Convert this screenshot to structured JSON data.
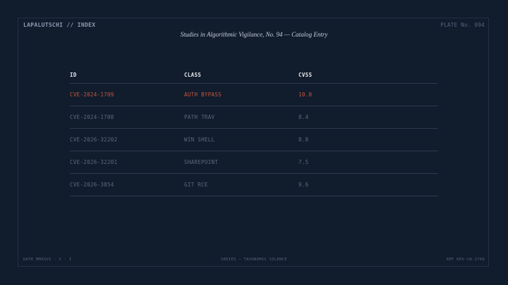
{
  "header": {
    "brand": "LAPALUTSCHI // INDEX",
    "plate": "PLATE No. 094",
    "subtitle": "Studies in Algorithmic Vigilance, No. 94 — Catalog Entry"
  },
  "table": {
    "columns": [
      "ID",
      "CLASS",
      "CVSS"
    ],
    "rows": [
      {
        "id": "CVE-2024-1709",
        "class": "AUTH BYPASS",
        "cvss": "10.0",
        "highlighted": true
      },
      {
        "id": "CVE-2024-1708",
        "class": "PATH TRAV",
        "cvss": "8.4",
        "highlighted": false
      },
      {
        "id": "CVE-2026-32202",
        "class": "WIN SHELL",
        "cvss": "8.8",
        "highlighted": false
      },
      {
        "id": "CVE-2026-32201",
        "class": "SHAREPOINT",
        "cvss": "7.5",
        "highlighted": false
      },
      {
        "id": "CVE-2026-3854",
        "class": "GIT RCE",
        "cvss": "9.6",
        "highlighted": false
      }
    ]
  },
  "footer": {
    "date": "DATE  MMXXVI · V · I",
    "series": "SERIES — TAXONOMIC SILENCE",
    "ref": "REF  KEV-CW-1709"
  },
  "colors": {
    "background": "#111c2c",
    "highlight": "#c5583a",
    "muted_text": "#5d6a7f",
    "header_text": "#e6e9ee",
    "rule": "#2d3a4f"
  }
}
